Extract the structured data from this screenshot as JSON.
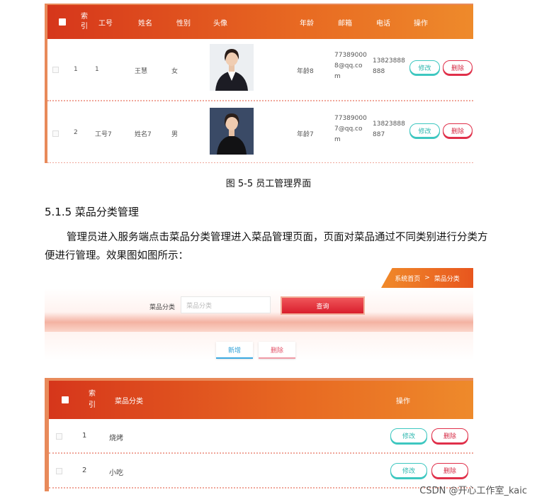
{
  "figure1": {
    "headers": [
      "索引",
      "工号",
      "姓名",
      "性别",
      "头像",
      "年龄",
      "邮箱",
      "电话",
      "操作"
    ],
    "rows": [
      {
        "index": "1",
        "job_no": "1",
        "name": "王慧",
        "gender": "女",
        "age": "年龄8",
        "email": [
          "77389000",
          "8@qq.co",
          "m"
        ],
        "phone": [
          "13823888",
          "888"
        ]
      },
      {
        "index": "2",
        "job_no": "工号7",
        "name": "姓名7",
        "gender": "男",
        "age": "年龄7",
        "email": [
          "77389000",
          "7@qq.co",
          "m"
        ],
        "phone": [
          "13823888",
          "887"
        ]
      }
    ],
    "edit_label": "修改",
    "delete_label": "删除"
  },
  "caption1": "图 5-5 员工管理界面",
  "section_title": "5.1.5 菜品分类管理",
  "paragraph": "管理员进入服务端点击菜品分类管理进入菜品管理页面，页面对菜品通过不同类别进行分类方便进行管理。效果图如图所示：",
  "figure2": {
    "breadcrumb_home": "系统首页",
    "breadcrumb_sep": ">",
    "breadcrumb_current": "菜品分类",
    "search_label": "菜品分类",
    "search_placeholder": "菜品分类",
    "query_label": "查询",
    "add_label": "新增",
    "delete_label": "删除"
  },
  "figure3": {
    "headers": [
      "索引",
      "菜品分类",
      "操作"
    ],
    "rows": [
      {
        "index": "1",
        "category": "烧烤"
      },
      {
        "index": "2",
        "category": "小吃"
      }
    ],
    "edit_label": "修改",
    "delete_label": "删除"
  },
  "watermark": "CSDN @开心工作室_kaic"
}
